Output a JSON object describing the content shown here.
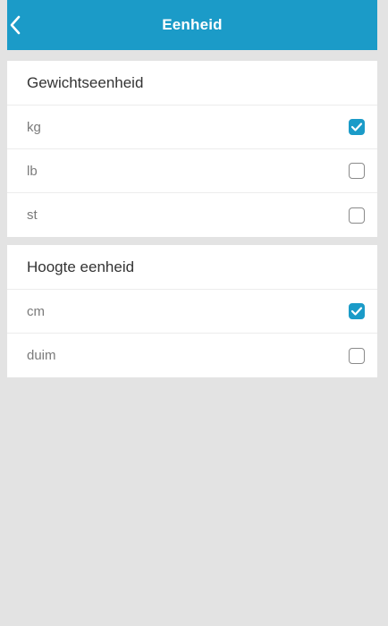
{
  "header": {
    "title": "Eenheid",
    "back_icon": "chevron-left-icon"
  },
  "colors": {
    "accent": "#1b9bc8",
    "background": "#e3e3e3"
  },
  "sections": [
    {
      "title": "Gewichtseenheid",
      "options": [
        {
          "label": "kg",
          "checked": true
        },
        {
          "label": "lb",
          "checked": false
        },
        {
          "label": "st",
          "checked": false
        }
      ]
    },
    {
      "title": "Hoogte eenheid",
      "options": [
        {
          "label": "cm",
          "checked": true
        },
        {
          "label": "duim",
          "checked": false
        }
      ]
    }
  ]
}
